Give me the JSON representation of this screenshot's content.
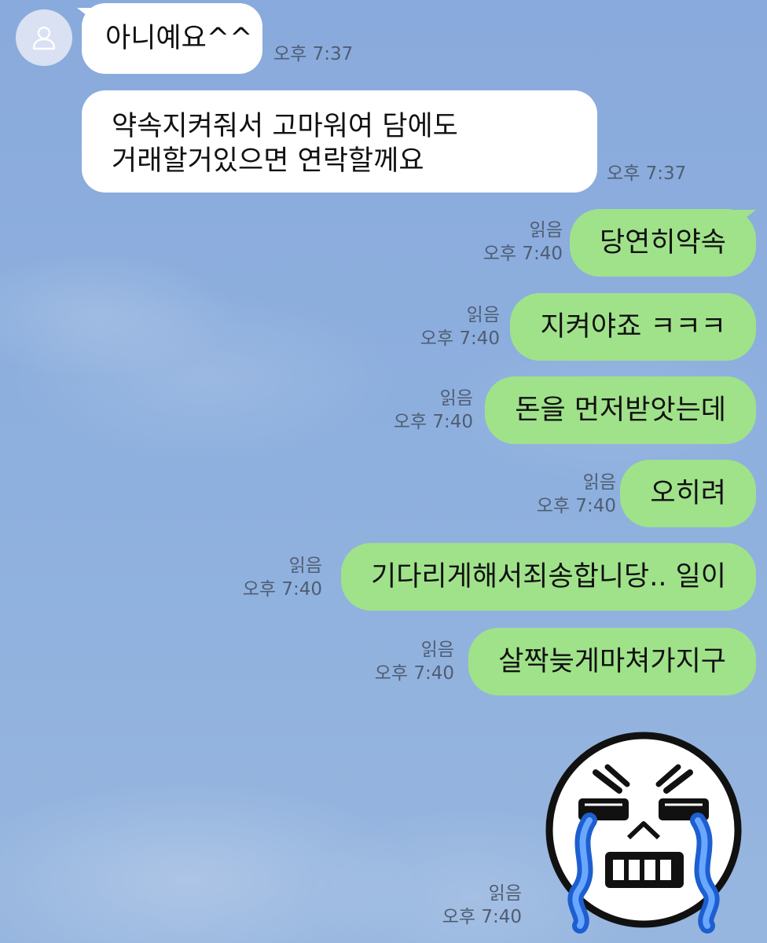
{
  "incoming": [
    {
      "text": "아니예요^^",
      "time": "오후 7:37"
    },
    {
      "lines": [
        "약속지켜줘서 고마워여 담에도",
        "거래할거있으면 연락할께요"
      ],
      "time": "오후 7:37"
    }
  ],
  "outgoing": [
    {
      "text": "당연히약속",
      "read": "읽음",
      "time": "오후 7:40"
    },
    {
      "text": "지켜야죠 ㅋㅋㅋ",
      "read": "읽음",
      "time": "오후 7:40"
    },
    {
      "text": "돈을 먼저받앗는데",
      "read": "읽음",
      "time": "오후 7:40"
    },
    {
      "text": "오히려",
      "read": "읽음",
      "time": "오후 7:40"
    },
    {
      "text": "기다리게해서죄송합니당.. 일이",
      "read": "읽음",
      "time": "오후 7:40"
    },
    {
      "text": "살짝늦게마쳐가지구",
      "read": "읽음",
      "time": "오후 7:40"
    }
  ],
  "sticker": {
    "icon": "crying-face-sticker",
    "read": "읽음",
    "time": "오후 7:40"
  },
  "colors": {
    "background": "#8eafdc",
    "incoming_bubble": "#ffffff",
    "outgoing_bubble": "#a0e28a",
    "meta_text": "#4f5d73"
  }
}
